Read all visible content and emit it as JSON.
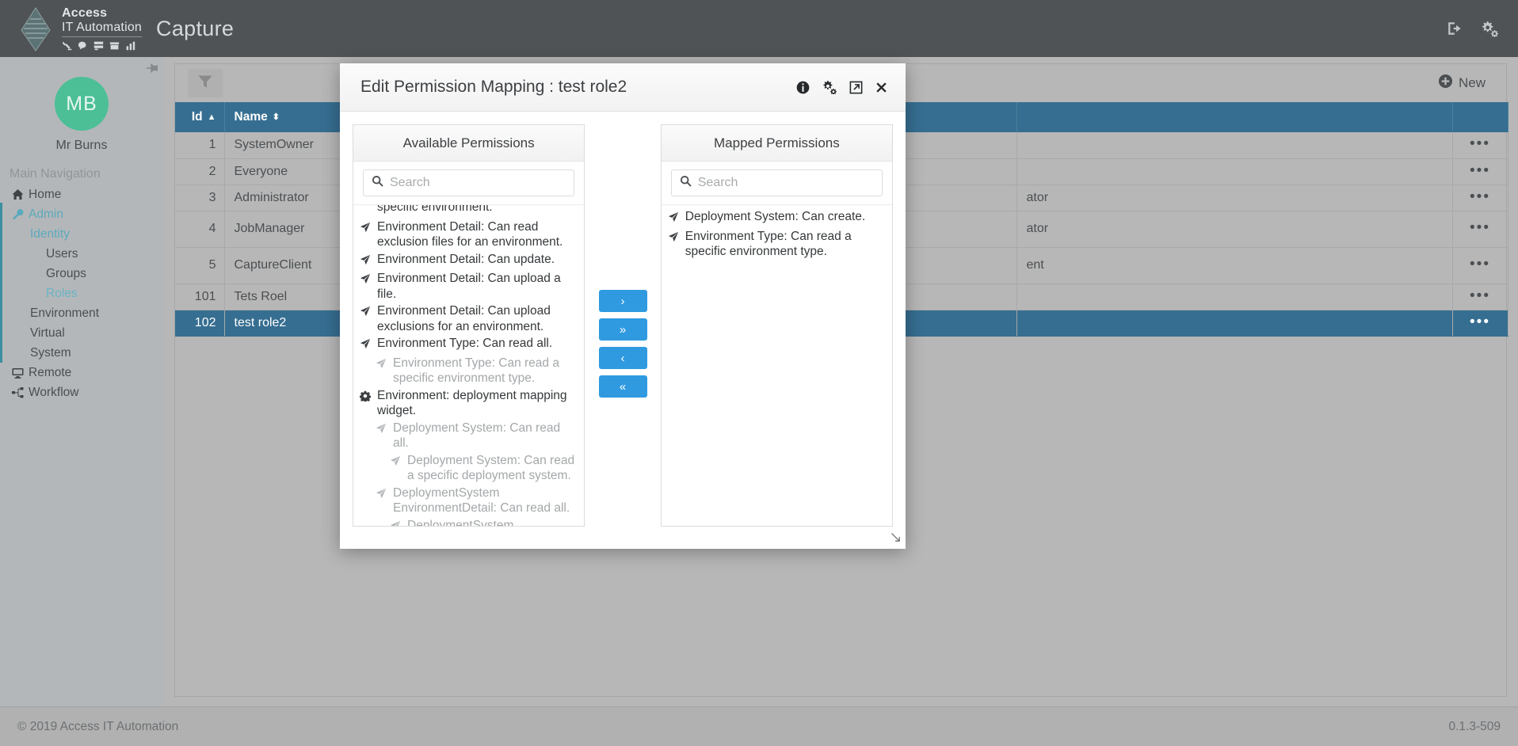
{
  "topbar": {
    "brand_line1": "Access",
    "brand_line2": "IT Automation",
    "app_title": "Capture",
    "brand_icons": [
      "robot-arm-icon",
      "chat-icon",
      "server-icon",
      "archive-icon",
      "chart-bar-icon"
    ],
    "right_icons": [
      "logout-icon",
      "cogs-icon"
    ]
  },
  "sidebar": {
    "pin_icon": "thumbtack-icon",
    "avatar_initials": "MB",
    "user_name": "Mr Burns",
    "nav_header": "Main Navigation",
    "items": [
      {
        "label": "Home",
        "icon": "home-icon",
        "level": 0,
        "active": false
      },
      {
        "label": "Admin",
        "icon": "wrench-icon",
        "level": 0,
        "active": true
      },
      {
        "label": "Identity",
        "icon": "",
        "level": 1,
        "active": true
      },
      {
        "label": "Users",
        "icon": "",
        "level": 2,
        "active": false
      },
      {
        "label": "Groups",
        "icon": "",
        "level": 2,
        "active": false
      },
      {
        "label": "Roles",
        "icon": "",
        "level": 2,
        "active": true
      },
      {
        "label": "Environment",
        "icon": "",
        "level": 1,
        "active": false
      },
      {
        "label": "Virtual",
        "icon": "",
        "level": 1,
        "active": false
      },
      {
        "label": "System",
        "icon": "",
        "level": 1,
        "active": false
      },
      {
        "label": "Remote",
        "icon": "desktop-icon",
        "level": 0,
        "active": false
      },
      {
        "label": "Workflow",
        "icon": "sitemap-icon",
        "level": 0,
        "active": false
      }
    ]
  },
  "toolbar": {
    "filter_icon": "filter-icon",
    "new_label": "New",
    "new_icon": "plus-circle-icon"
  },
  "grid": {
    "columns": [
      {
        "key": "id",
        "label": "Id",
        "sort": "asc"
      },
      {
        "key": "name",
        "label": "Name",
        "sort": "none"
      }
    ],
    "rows": [
      {
        "id": "1",
        "name": "SystemOwner",
        "desc": "",
        "selected": false,
        "tall": false
      },
      {
        "id": "2",
        "name": "Everyone",
        "desc": "",
        "selected": false,
        "tall": false
      },
      {
        "id": "3",
        "name": "Administrator",
        "desc": "ator",
        "selected": false,
        "tall": false
      },
      {
        "id": "4",
        "name": "JobManager",
        "desc": "ator",
        "selected": false,
        "tall": true
      },
      {
        "id": "5",
        "name": "CaptureClient",
        "desc": "ent",
        "selected": false,
        "tall": true
      },
      {
        "id": "101",
        "name": "Tets Roel",
        "desc": "",
        "selected": false,
        "tall": false
      },
      {
        "id": "102",
        "name": "test role2",
        "desc": "",
        "selected": true,
        "tall": false
      }
    ],
    "row_action_icon": "ellipsis-icon"
  },
  "modal": {
    "title": "Edit Permission Mapping : test role2",
    "header_icons": [
      "info-icon",
      "cogs-icon",
      "expand-icon",
      "close-icon"
    ],
    "resize_icon": "resize-handle-icon",
    "available": {
      "header": "Available Permissions",
      "search_placeholder": "Search",
      "search_value": "",
      "search_icon": "search-icon",
      "items": [
        {
          "text": "specific environment.",
          "icon": "paper-plane-icon",
          "level": 0,
          "muted": false,
          "clipped": true
        },
        {
          "text": "Environment Detail: Can read exclusion files for an environment.",
          "icon": "paper-plane-icon",
          "level": 0,
          "muted": false
        },
        {
          "text": "Environment Detail: Can update.",
          "icon": "paper-plane-icon",
          "level": 0,
          "muted": false
        },
        {
          "text": "Environment Detail: Can upload a file.",
          "icon": "paper-plane-icon",
          "level": 0,
          "muted": false
        },
        {
          "text": "Environment Detail: Can upload exclusions for an environment.",
          "icon": "paper-plane-icon",
          "level": 0,
          "muted": false
        },
        {
          "text": "Environment Type: Can read all.",
          "icon": "paper-plane-icon",
          "level": 0,
          "muted": false
        },
        {
          "text": "Environment Type: Can read a specific environment type.",
          "icon": "paper-plane-icon",
          "level": 1,
          "muted": true
        },
        {
          "text": "Environment: deployment mapping widget.",
          "icon": "gear-icon",
          "level": 0,
          "muted": false
        },
        {
          "text": "Deployment System: Can read all.",
          "icon": "paper-plane-icon",
          "level": 1,
          "muted": true
        },
        {
          "text": "Deployment System: Can read a specific deployment system.",
          "icon": "paper-plane-icon",
          "level": 2,
          "muted": true
        },
        {
          "text": "DeploymentSystem EnvironmentDetail: Can read all.",
          "icon": "paper-plane-icon",
          "level": 1,
          "muted": true
        },
        {
          "text": "DeploymentSystem EnvironmentDetail: Can read",
          "icon": "paper-plane-icon",
          "level": 2,
          "muted": true
        }
      ]
    },
    "transfer_buttons": [
      {
        "label": "›",
        "name": "move-right-button"
      },
      {
        "label": "»",
        "name": "move-all-right-button"
      },
      {
        "label": "‹",
        "name": "move-left-button"
      },
      {
        "label": "«",
        "name": "move-all-left-button"
      }
    ],
    "mapped": {
      "header": "Mapped Permissions",
      "search_placeholder": "Search",
      "search_value": "",
      "search_icon": "search-icon",
      "items": [
        {
          "text": "Deployment System: Can create.",
          "icon": "paper-plane-icon",
          "level": 0,
          "muted": false
        },
        {
          "text": "Environment Type: Can read a specific environment type.",
          "icon": "paper-plane-icon",
          "level": 0,
          "muted": false
        }
      ]
    }
  },
  "footer": {
    "copyright": "© 2019 Access IT Automation",
    "version": "0.1.3-509"
  },
  "colors": {
    "topbar": "#4f5356",
    "sidebar": "#b4b7b9",
    "accent_blue": "#366e91",
    "button_blue": "#2f9ae0",
    "avatar_green": "#4cbf97",
    "link_teal": "#5aa9bd"
  }
}
